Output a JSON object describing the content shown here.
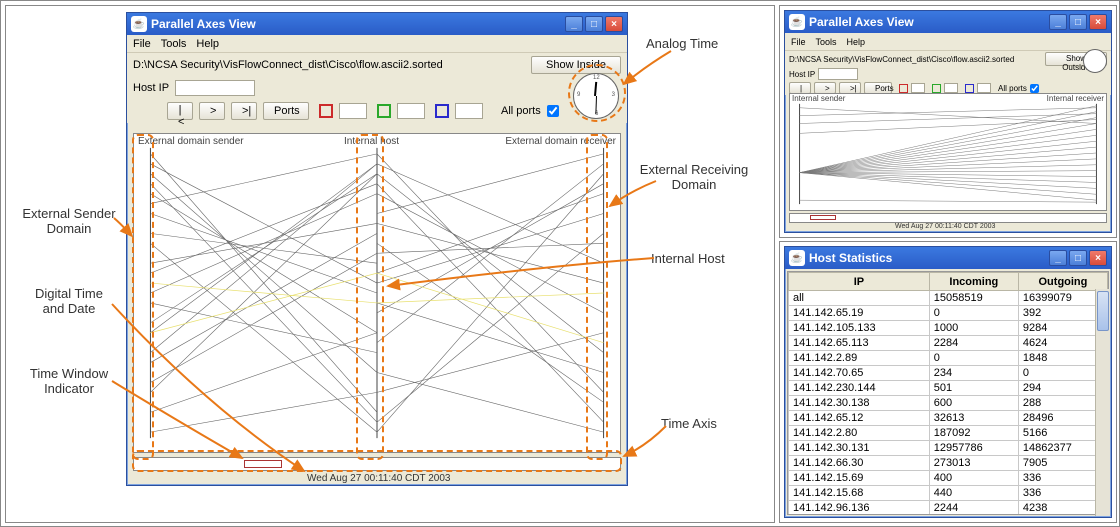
{
  "main_window": {
    "title": "Parallel Axes View",
    "menus": [
      "File",
      "Tools",
      "Help"
    ],
    "path": "D:\\NCSA Security\\VisFlowConnect_dist\\Cisco\\flow.ascii2.sorted",
    "show_inside": "Show Inside",
    "host_ip_label": "Host IP",
    "host_ip_value": "",
    "nav": {
      "first": "|<",
      "play": ">",
      "last": ">|"
    },
    "ports_btn": "Ports",
    "all_ports_label": "All ports",
    "all_ports_checked": true,
    "colors": {
      "red": "#cc2a2a",
      "green": "#2aa82a",
      "blue": "#2a2acc"
    },
    "axis_labels": {
      "left": "External domain sender",
      "mid": "Internal host",
      "right": "External domain receiver"
    },
    "digital_time": "Wed Aug 27 00:11:40 CDT 2003"
  },
  "outside_window": {
    "title": "Parallel Axes View",
    "menus": [
      "File",
      "Tools",
      "Help"
    ],
    "path": "D:\\NCSA Security\\VisFlowConnect_dist\\Cisco\\flow.ascii2.sorted",
    "show_outside": "Show Outside",
    "host_ip_label": "Host IP",
    "all_ports_label": "All ports",
    "axis_labels": {
      "left": "Internal sender",
      "right": "Internal receiver"
    },
    "digital_time": "Wed Aug 27 00:11:40 CDT 2003"
  },
  "stats_window": {
    "title": "Host Statistics",
    "columns": [
      "IP",
      "Incoming",
      "Outgoing"
    ],
    "rows": [
      [
        "all",
        "15058519",
        "16399079"
      ],
      [
        "141.142.65.19",
        "0",
        "392"
      ],
      [
        "141.142.105.133",
        "1000",
        "9284"
      ],
      [
        "141.142.65.113",
        "2284",
        "4624"
      ],
      [
        "141.142.2.89",
        "0",
        "1848"
      ],
      [
        "141.142.70.65",
        "234",
        "0"
      ],
      [
        "141.142.230.144",
        "501",
        "294"
      ],
      [
        "141.142.30.138",
        "600",
        "288"
      ],
      [
        "141.142.65.12",
        "32613",
        "28496"
      ],
      [
        "141.142.2.80",
        "187092",
        "5166"
      ],
      [
        "141.142.30.131",
        "12957786",
        "14862377"
      ],
      [
        "141.142.66.30",
        "273013",
        "7905"
      ],
      [
        "141.142.15.69",
        "400",
        "336"
      ],
      [
        "141.142.15.68",
        "440",
        "336"
      ],
      [
        "141.142.96.136",
        "2244",
        "4238"
      ]
    ]
  },
  "callouts": {
    "analog": "Analog Time",
    "ers": "External Sender\nDomain",
    "erd": "External Receiving\nDomain",
    "ih": "Internal Host",
    "dtd": "Digital Time\nand Date",
    "twi": "Time Window\nIndicator",
    "ta": "Time Axis"
  }
}
